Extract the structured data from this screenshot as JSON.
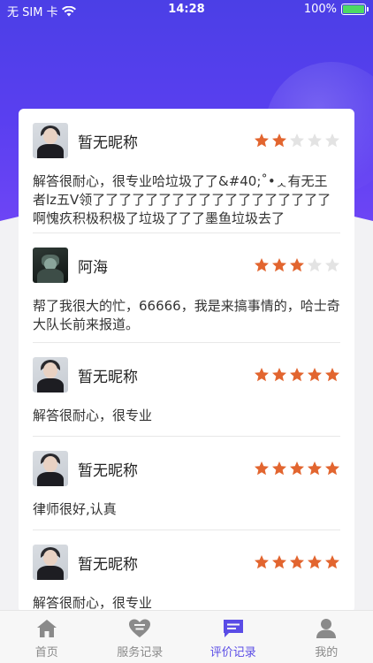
{
  "status_bar": {
    "carrier": "无 SIM 卡",
    "time": "14:28",
    "battery": "100%"
  },
  "reviews": [
    {
      "name": "暂无昵称",
      "rating": 2,
      "avatar": "woman-portrait",
      "text": "解答很耐心，很专业哈垃圾了了&#40;˚•ᆺ有无王者lz五V领了了了了了了了了了了了了了了了了了了啊愧疚积极积极了垃圾了了了墨鱼垃圾去了"
    },
    {
      "name": "阿海",
      "rating": 3,
      "avatar": "dark-scene",
      "text": "帮了我很大的忙，66666，我是来搞事情的，哈士奇大队长前来报道。"
    },
    {
      "name": "暂无昵称",
      "rating": 5,
      "avatar": "woman-portrait",
      "text": "解答很耐心，很专业"
    },
    {
      "name": "暂无昵称",
      "rating": 5,
      "avatar": "woman-portrait",
      "text": "律师很好,认真"
    },
    {
      "name": "暂无昵称",
      "rating": 5,
      "avatar": "woman-portrait",
      "text": "解答很耐心，很专业"
    }
  ],
  "max_rating": 5,
  "colors": {
    "star_on": "#e2652f",
    "star_off": "#e3e3e3",
    "accent": "#5a4ce6"
  },
  "tabs": [
    {
      "label": "首页",
      "icon": "home-icon",
      "active": false
    },
    {
      "label": "服务记录",
      "icon": "heart-list-icon",
      "active": false
    },
    {
      "label": "评价记录",
      "icon": "chat-icon",
      "active": true
    },
    {
      "label": "我的",
      "icon": "person-icon",
      "active": false
    }
  ]
}
